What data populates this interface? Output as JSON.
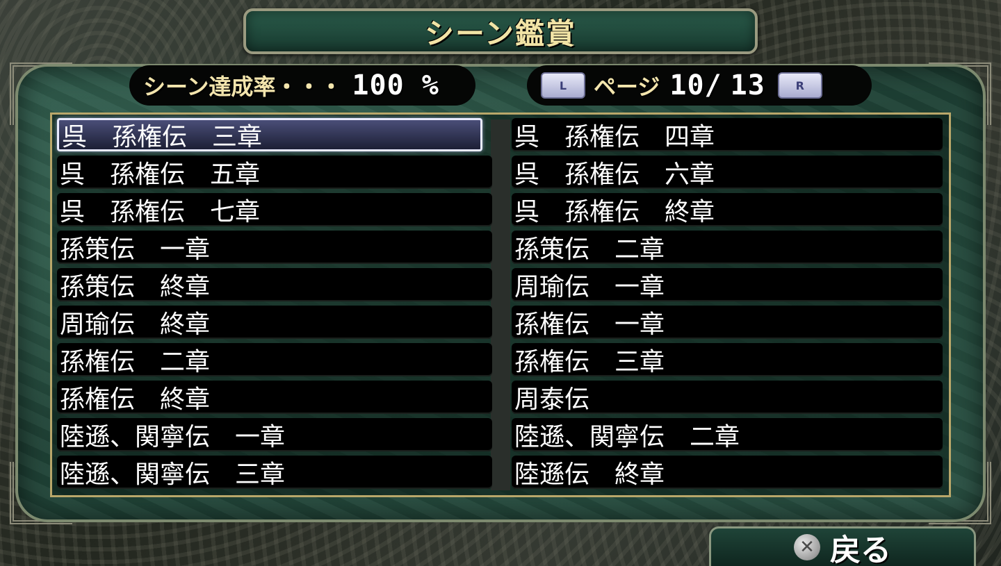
{
  "title": "シーン鑑賞",
  "completion": {
    "label": "シーン達成率・・・",
    "value": "100 %"
  },
  "pager": {
    "left_button": "L",
    "label": "ページ",
    "current": "10/",
    "total": "13",
    "right_button": "R"
  },
  "scenes": {
    "left": [
      "呉　孫権伝　三章",
      "呉　孫権伝　五章",
      "呉　孫権伝　七章",
      "孫策伝　一章",
      "孫策伝　終章",
      "周瑜伝　終章",
      "孫権伝　二章",
      "孫権伝　終章",
      "陸遜、関寧伝　一章",
      "陸遜、関寧伝　三章"
    ],
    "right": [
      "呉　孫権伝　四章",
      "呉　孫権伝　六章",
      "呉　孫権伝　終章",
      "孫策伝　二章",
      "周瑜伝　一章",
      "孫権伝　一章",
      "孫権伝　三章",
      "周泰伝",
      "陸遜、関寧伝　二章",
      "陸遜伝　終章"
    ],
    "selected_index": 0
  },
  "back": {
    "icon": "cross-button-icon",
    "label": "戻る"
  },
  "colors": {
    "title_text": "#f2e4a6",
    "panel_green": "#1f4236",
    "frame_gold": "#b9a76a",
    "selection": "#4a4e78"
  }
}
